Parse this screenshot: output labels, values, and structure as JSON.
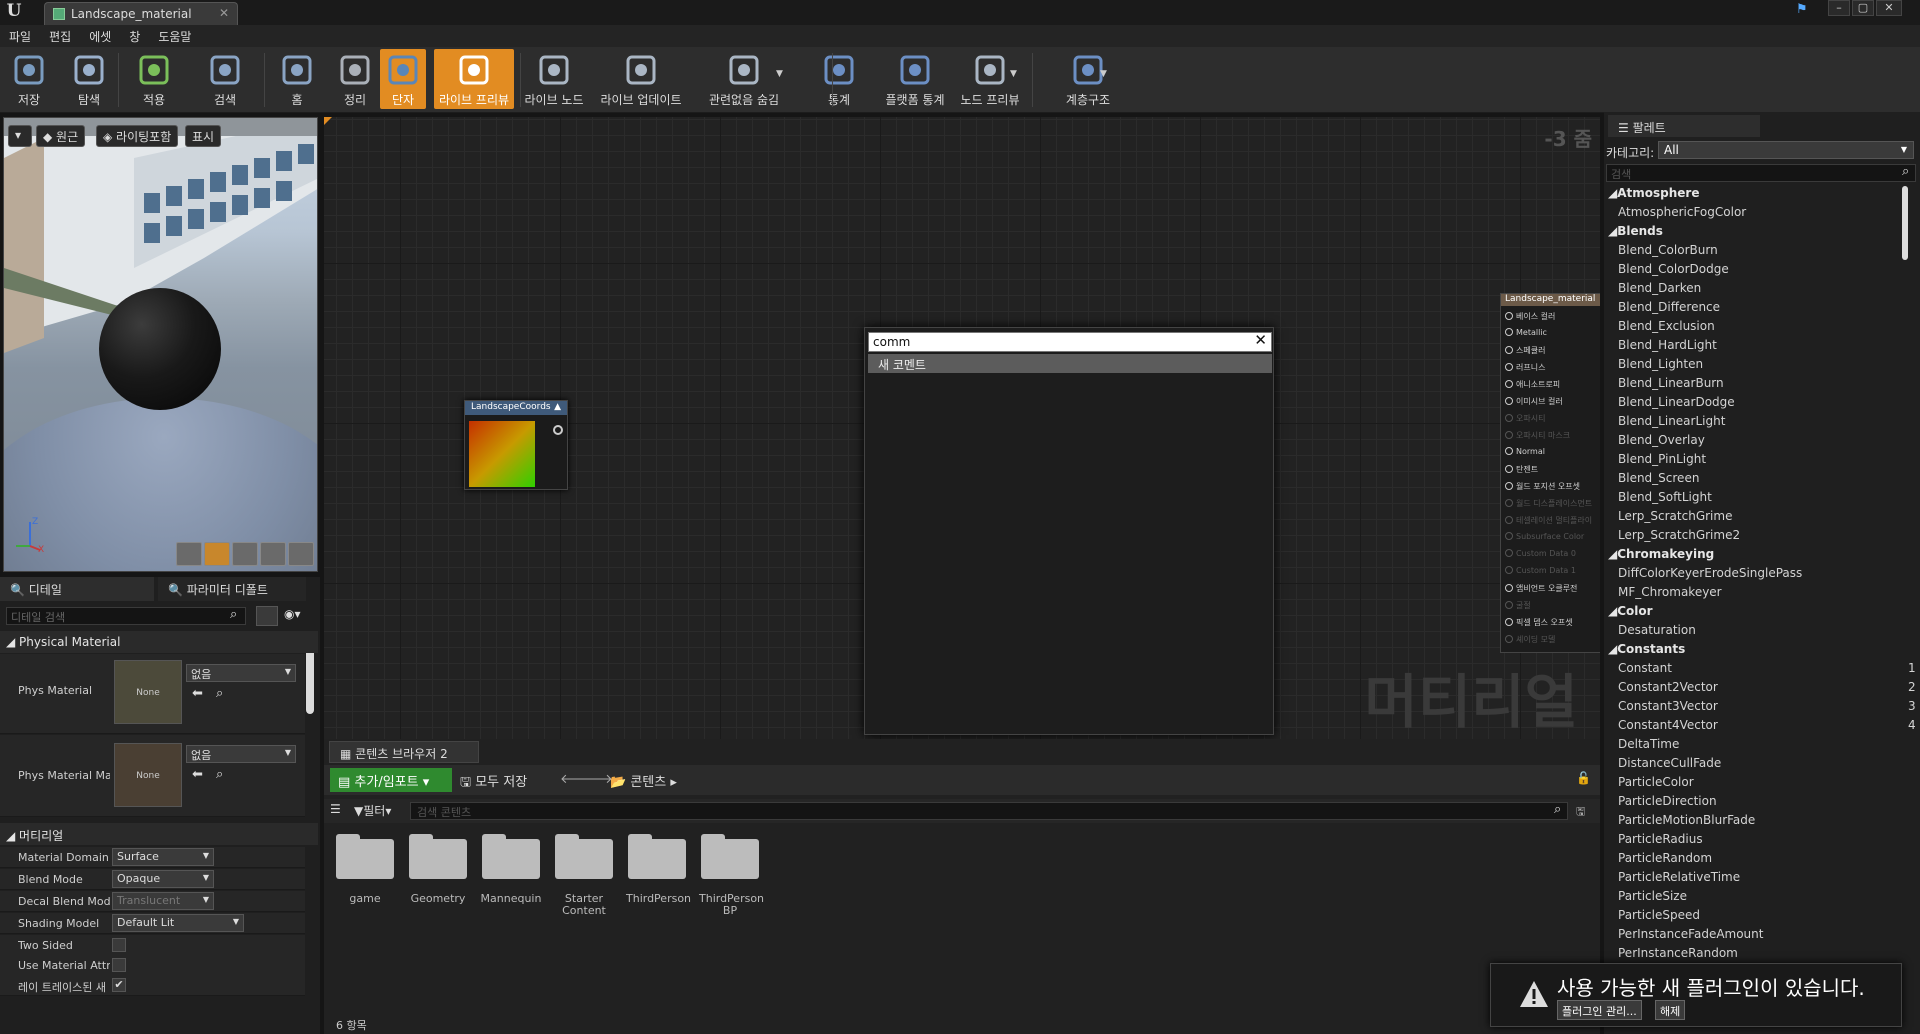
{
  "window": {
    "tab_title": "Landscape_material"
  },
  "menu": [
    "파일",
    "편집",
    "에셋",
    "창",
    "도움말"
  ],
  "toolbar": [
    {
      "label": "저장",
      "icon": "save-icon"
    },
    {
      "label": "탐색",
      "icon": "browse-icon"
    },
    {
      "label": "적용",
      "icon": "apply-icon"
    },
    {
      "label": "검색",
      "icon": "search-icon"
    },
    {
      "label": "홈",
      "icon": "home-icon"
    },
    {
      "label": "정리",
      "icon": "clean-icon"
    },
    {
      "label": "단자",
      "icon": "connectors-icon"
    },
    {
      "label": "라이브 프리뷰",
      "icon": "live-preview-icon"
    },
    {
      "label": "라이브 노드",
      "icon": "live-nodes-icon"
    },
    {
      "label": "라이브 업데이트",
      "icon": "live-update-icon"
    },
    {
      "label": "관련없음 숨김",
      "icon": "hide-unrelated-icon"
    },
    {
      "label": "통계",
      "icon": "stats-icon"
    },
    {
      "label": "플랫폼 통계",
      "icon": "platform-stats-icon"
    },
    {
      "label": "노드 프리뷰",
      "icon": "node-preview-icon"
    },
    {
      "label": "계층구조",
      "icon": "hierarchy-icon"
    }
  ],
  "viewport": {
    "perspective": "원근",
    "lighting": "라이팅포함",
    "show": "표시"
  },
  "details": {
    "tab_details": "디테일",
    "tab_params": "파라미터 디폴트",
    "search_placeholder": "디테일 검색",
    "section_physical": "Physical Material",
    "phys_material_label": "Phys Material",
    "phys_material_ma_label": "Phys Material Ma",
    "none_text": "None",
    "none_value": "없음",
    "section_material": "머티리얼",
    "rows": [
      {
        "label": "Material Domain",
        "value": "Surface"
      },
      {
        "label": "Blend Mode",
        "value": "Opaque"
      },
      {
        "label": "Decal Blend Mode",
        "value": "Translucent"
      },
      {
        "label": "Shading Model",
        "value": "Default Lit"
      },
      {
        "label": "Two Sided",
        "value": ""
      },
      {
        "label": "Use Material Attri",
        "value": ""
      },
      {
        "label": "레이 트레이스된 새",
        "value": "✔"
      }
    ]
  },
  "graph": {
    "zoom": "-3 줌",
    "watermark": "머티리얼",
    "coord_node_title": "LandscapeCoords",
    "search_value": "comm",
    "search_result": "새 코멘트",
    "material_node": {
      "title": "Landscape_material",
      "pins": [
        {
          "label": "베이스 컬러",
          "active": true
        },
        {
          "label": "Metallic",
          "active": true
        },
        {
          "label": "스페큘러",
          "active": true
        },
        {
          "label": "러프니스",
          "active": true
        },
        {
          "label": "애니소트로피",
          "active": true
        },
        {
          "label": "이미시브 컬러",
          "active": true
        },
        {
          "label": "오파시티",
          "active": false
        },
        {
          "label": "오파시티 마스크",
          "active": false
        },
        {
          "label": "Normal",
          "active": true
        },
        {
          "label": "탄젠트",
          "active": true
        },
        {
          "label": "월드 포지션 오프셋",
          "active": true
        },
        {
          "label": "월드 디스플레이스먼트",
          "active": false
        },
        {
          "label": "테셀레이션 멀티플라이",
          "active": false
        },
        {
          "label": "Subsurface Color",
          "active": false
        },
        {
          "label": "Custom Data 0",
          "active": false
        },
        {
          "label": "Custom Data 1",
          "active": false
        },
        {
          "label": "앰비언트 오클루전",
          "active": true
        },
        {
          "label": "굴절",
          "active": false
        },
        {
          "label": "픽셀 뎁스 오프셋",
          "active": true
        },
        {
          "label": "셰이딩 모델",
          "active": false
        }
      ]
    }
  },
  "content_browser": {
    "tab": "콘텐츠 브라우저 2",
    "add_import": "추가/임포트",
    "save_all": "모두 저장",
    "path": "콘텐츠",
    "filter": "필터",
    "search_placeholder": "검색 콘텐츠",
    "folders": [
      "game",
      "Geometry",
      "Mannequin",
      "Starter Content",
      "ThirdPerson",
      "ThirdPerson BP"
    ],
    "count": "6 항목"
  },
  "palette": {
    "tab": "팔레트",
    "category_label": "카테고리:",
    "category_value": "All",
    "search_placeholder": "검색",
    "items": [
      {
        "t": "Atmosphere",
        "cat": true
      },
      {
        "t": "AtmosphericFogColor"
      },
      {
        "t": "Blends",
        "cat": true
      },
      {
        "t": "Blend_ColorBurn"
      },
      {
        "t": "Blend_ColorDodge"
      },
      {
        "t": "Blend_Darken"
      },
      {
        "t": "Blend_Difference"
      },
      {
        "t": "Blend_Exclusion"
      },
      {
        "t": "Blend_HardLight"
      },
      {
        "t": "Blend_Lighten"
      },
      {
        "t": "Blend_LinearBurn"
      },
      {
        "t": "Blend_LinearDodge"
      },
      {
        "t": "Blend_LinearLight"
      },
      {
        "t": "Blend_Overlay"
      },
      {
        "t": "Blend_PinLight"
      },
      {
        "t": "Blend_Screen"
      },
      {
        "t": "Blend_SoftLight"
      },
      {
        "t": "Lerp_ScratchGrime"
      },
      {
        "t": "Lerp_ScratchGrime2"
      },
      {
        "t": "Chromakeying",
        "cat": true
      },
      {
        "t": "DiffColorKeyerErodeSinglePass"
      },
      {
        "t": "MF_Chromakeyer"
      },
      {
        "t": "Color",
        "cat": true
      },
      {
        "t": "Desaturation"
      },
      {
        "t": "Constants",
        "cat": true
      },
      {
        "t": "Constant",
        "n": "1"
      },
      {
        "t": "Constant2Vector",
        "n": "2"
      },
      {
        "t": "Constant3Vector",
        "n": "3"
      },
      {
        "t": "Constant4Vector",
        "n": "4"
      },
      {
        "t": "DeltaTime"
      },
      {
        "t": "DistanceCullFade"
      },
      {
        "t": "ParticleColor"
      },
      {
        "t": "ParticleDirection"
      },
      {
        "t": "ParticleMotionBlurFade"
      },
      {
        "t": "ParticleRadius"
      },
      {
        "t": "ParticleRandom"
      },
      {
        "t": "ParticleRelativeTime"
      },
      {
        "t": "ParticleSize"
      },
      {
        "t": "ParticleSpeed"
      },
      {
        "t": "PerInstanceFadeAmount"
      },
      {
        "t": "PerInstanceRandom"
      }
    ]
  },
  "notification": {
    "message": "사용 가능한 새 플러그인이 있습니다.",
    "manage": "플러그인 관리...",
    "dismiss": "해제"
  }
}
